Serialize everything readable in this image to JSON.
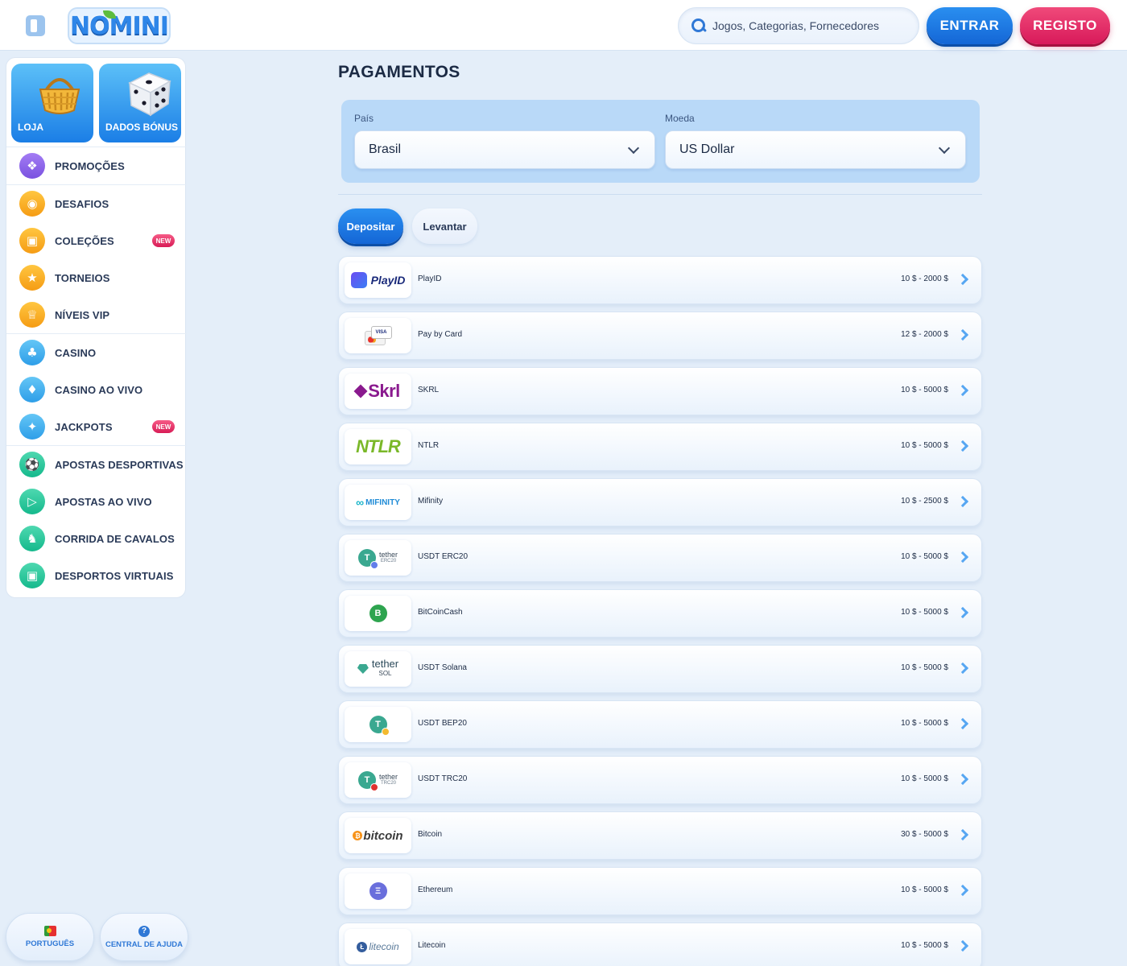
{
  "header": {
    "logo_text": "NOMINI",
    "search_placeholder": "Jogos, Categorias, Fornecedores",
    "login_label": "ENTRAR",
    "register_label": "REGISTO"
  },
  "sidebar": {
    "tiles": [
      {
        "label": "LOJA",
        "icon": "basket-icon"
      },
      {
        "label": "DADOS BÓNUS",
        "icon": "dice-icon"
      }
    ],
    "items": [
      {
        "label": "PROMOÇÕES",
        "icon": "gift-icon"
      },
      {
        "label": "DESAFIOS",
        "icon": "medal-icon"
      },
      {
        "label": "COLEÇÕES",
        "icon": "cards-icon",
        "badge": "NEW"
      },
      {
        "label": "TORNEIOS",
        "icon": "trophy-icon"
      },
      {
        "label": "NÍVEIS VIP",
        "icon": "crown-icon"
      },
      {
        "label": "CASINO",
        "icon": "clubs-icon"
      },
      {
        "label": "CASINO AO VIVO",
        "icon": "live-card-icon"
      },
      {
        "label": "JACKPOTS",
        "icon": "jackpot-icon",
        "badge": "NEW"
      },
      {
        "label": "APOSTAS DESPORTIVAS",
        "icon": "football-icon"
      },
      {
        "label": "APOSTAS AO VIVO",
        "icon": "live-tv-icon"
      },
      {
        "label": "CORRIDA DE CAVALOS",
        "icon": "horse-icon"
      },
      {
        "label": "DESPORTOS VIRTUAIS",
        "icon": "virtual-sports-icon"
      }
    ],
    "language_label": "PORTUGUÊS",
    "help_label": "CENTRAL DE AJUDA"
  },
  "main": {
    "title": "PAGAMENTOS",
    "country_label": "País",
    "country_value": "Brasil",
    "currency_label": "Moeda",
    "currency_value": "US Dollar",
    "tabs": {
      "deposit": "Depositar",
      "withdraw": "Levantar"
    },
    "methods": [
      {
        "name": "PlayID",
        "limits": "10 $ - 2000 $",
        "logo": "PlayID"
      },
      {
        "name": "Pay by Card",
        "limits": "12 $ - 2000 $",
        "logo": "VISA"
      },
      {
        "name": "SKRL",
        "limits": "10 $ - 5000 $",
        "logo": "Skrl"
      },
      {
        "name": "NTLR",
        "limits": "10 $ - 5000 $",
        "logo": "NTLR"
      },
      {
        "name": "Mifinity",
        "limits": "10 $ - 2500 $",
        "logo": "MIFINITY"
      },
      {
        "name": "USDT ERC20",
        "limits": "10 $ - 5000 $",
        "logo": "tether",
        "logo_sub": "ERC20"
      },
      {
        "name": "BitCoinCash",
        "limits": "10 $ - 5000 $",
        "logo": "B"
      },
      {
        "name": "USDT Solana",
        "limits": "10 $ - 5000 $",
        "logo": "tether",
        "logo_sub": "SOL"
      },
      {
        "name": "USDT BEP20",
        "limits": "10 $ - 5000 $",
        "logo": "T"
      },
      {
        "name": "USDT TRC20",
        "limits": "10 $ - 5000 $",
        "logo": "tether",
        "logo_sub": "TRC20"
      },
      {
        "name": "Bitcoin",
        "limits": "30 $ - 5000 $",
        "logo": "bitcoin"
      },
      {
        "name": "Ethereum",
        "limits": "10 $ - 5000 $",
        "logo": "Ξ"
      },
      {
        "name": "Litecoin",
        "limits": "10 $ - 5000 $",
        "logo": "litecoin"
      }
    ]
  },
  "colors": {
    "accent_blue": "#1e7be6",
    "accent_pink": "#e62a66",
    "background": "#e4eef9"
  }
}
